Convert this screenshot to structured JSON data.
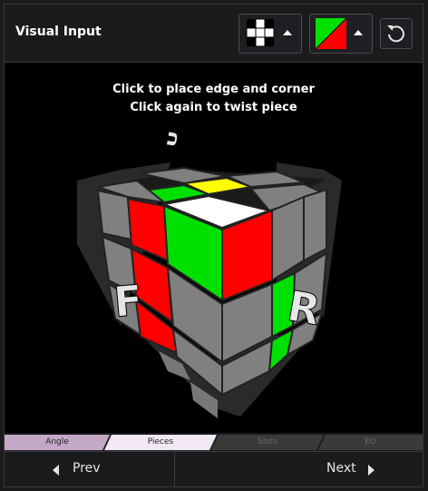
{
  "panel": {
    "title": "Visual Input"
  },
  "toolbar": {
    "pattern_icon": "cross-pattern-icon",
    "color_icon": "green-red-swatch-icon",
    "reset_icon": "reset-icon",
    "swatch_colors": [
      "#00e000",
      "#ff0000"
    ]
  },
  "viewport": {
    "instruction_line1": "Click to place edge and corner",
    "instruction_line2": "Click again to twist piece",
    "face_labels": {
      "up": "U",
      "front": "F",
      "right": "R"
    },
    "sticker_colors": {
      "white": "#ffffff",
      "green": "#00e000",
      "red": "#ff0000",
      "yellow": "#ffff00",
      "gray": "#808080"
    }
  },
  "tabs": [
    {
      "label": "Angle",
      "state": "done"
    },
    {
      "label": "Pieces",
      "state": "active"
    },
    {
      "label": "Slots",
      "state": "inactive"
    },
    {
      "label": "EO",
      "state": "inactive"
    }
  ],
  "nav": {
    "prev_label": "Prev",
    "next_label": "Next"
  }
}
